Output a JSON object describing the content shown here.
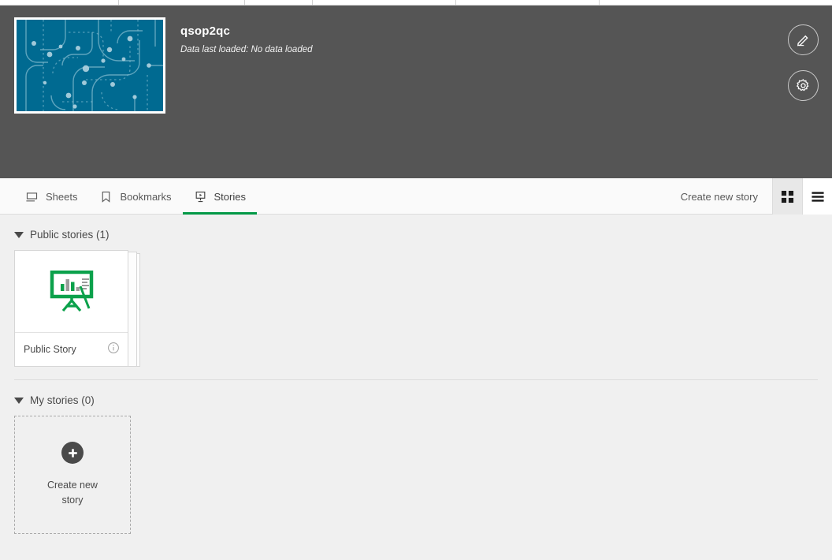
{
  "app": {
    "title": "qsop2qc",
    "data_status": "Data last loaded: No data loaded",
    "edit_button_label": "Edit",
    "settings_button_label": "App settings",
    "thumbnail_color": "#006a91"
  },
  "tabs": [
    {
      "label": "Sheets",
      "icon": "sheet-icon",
      "active": false
    },
    {
      "label": "Bookmarks",
      "icon": "bookmark-icon",
      "active": false
    },
    {
      "label": "Stories",
      "icon": "story-icon",
      "active": true
    }
  ],
  "toolbar": {
    "create_link": "Create new story",
    "grid_view_label": "Grid view",
    "list_view_label": "List view",
    "active_view": "grid",
    "accent_color": "#009845"
  },
  "sections": [
    {
      "title": "Public stories (1)",
      "expanded": true,
      "items": [
        {
          "name": "Public Story",
          "icon": "easel-chart-icon",
          "info_label": "Details"
        }
      ]
    },
    {
      "title": "My stories (0)",
      "expanded": true,
      "items": [],
      "placeholder": {
        "label_line1": "Create new",
        "label_line2": "story",
        "icon": "plus-icon"
      }
    }
  ]
}
